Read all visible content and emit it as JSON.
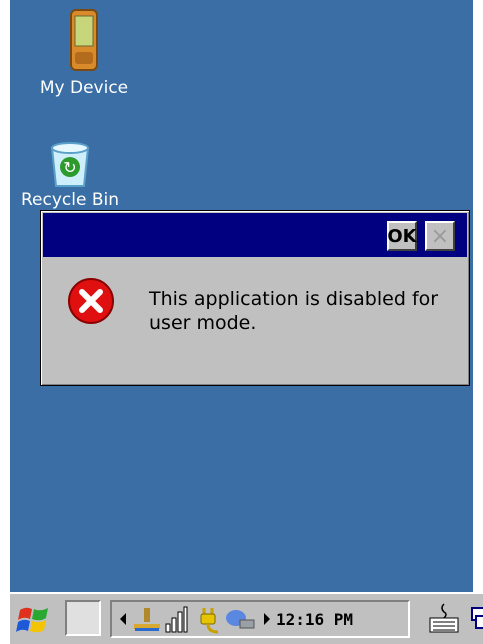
{
  "desktop": {
    "icons": [
      {
        "label": "My Device",
        "icon": "pocket-device-icon"
      },
      {
        "label": "Recycle Bin",
        "icon": "recycle-bin-icon"
      }
    ],
    "background_color": "#3A6EA5"
  },
  "dialog": {
    "ok_label": "OK",
    "close_label": "×",
    "message": "This application is disabled for user mode.",
    "icon": "error-icon"
  },
  "taskbar": {
    "start_icon": "windows-flag-icon",
    "tray_icons": [
      "arrow-left-icon",
      "network-icon",
      "signal-bars-icon",
      "power-plug-icon",
      "connectivity-icon",
      "arrow-right-icon"
    ],
    "clock": "12:16 PM",
    "keyboard_icon": "keyboard-icon",
    "desktop_icon": "show-desktop-icon"
  }
}
